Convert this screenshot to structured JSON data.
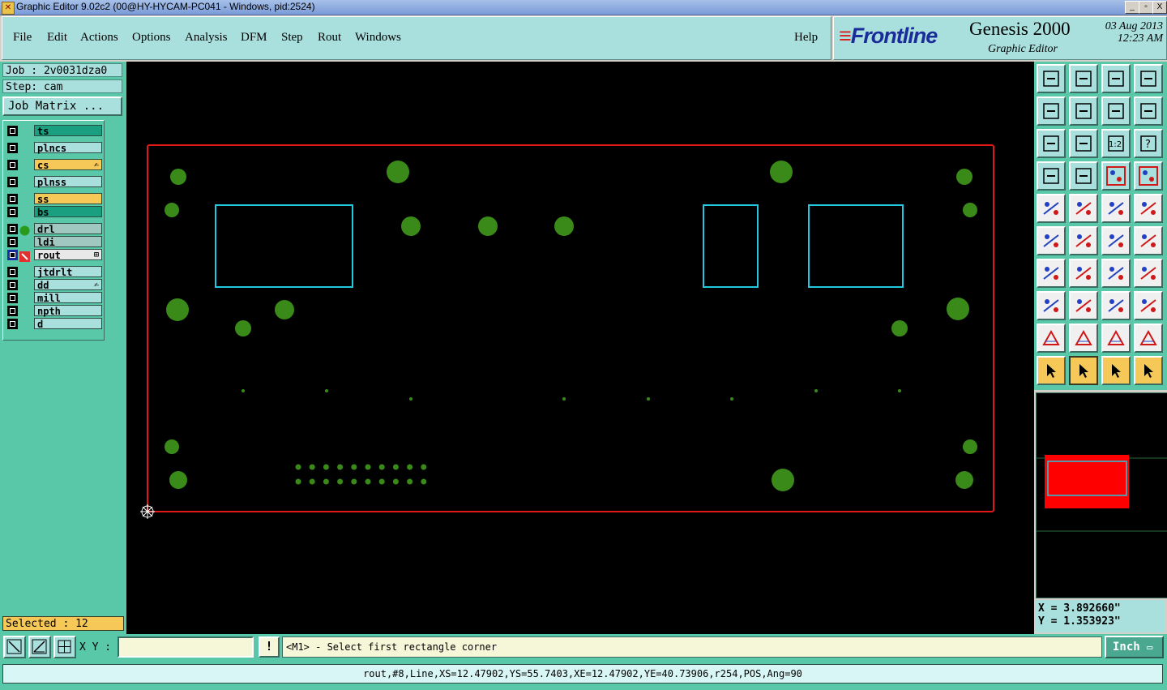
{
  "window": {
    "title": "Graphic Editor 9.02c2 (00@HY-HYCAM-PC041 - Windows, pid:2524)",
    "buttons": [
      "_",
      "▫",
      "X"
    ]
  },
  "menu": {
    "items": [
      "File",
      "Edit",
      "Actions",
      "Options",
      "Analysis",
      "DFM",
      "Step",
      "Rout",
      "Windows"
    ],
    "help": "Help"
  },
  "brand": {
    "logo_text": "Frontline",
    "product": "Genesis 2000",
    "subtitle": "Graphic Editor",
    "date": "03 Aug 2013",
    "time": "12:23 AM"
  },
  "job": {
    "job_line": "Job : 2v0031dza0",
    "step_line": "Step: cam",
    "matrix_button": "Job Matrix ..."
  },
  "layers": [
    {
      "name": "ts",
      "color": "#1aa080",
      "dot": "",
      "mark": ""
    },
    {
      "name": "plncs",
      "color": "#a9e0de",
      "dot": "",
      "mark": ""
    },
    {
      "name": "cs",
      "color": "#f6c858",
      "dot": "",
      "mark": "✍"
    },
    {
      "name": "plnss",
      "color": "#a9e0de",
      "dot": "",
      "mark": ""
    },
    {
      "name": "ss",
      "color": "#f6c858",
      "dot": "",
      "mark": ""
    },
    {
      "name": "bs",
      "color": "#1aa080",
      "dot": "",
      "mark": ""
    },
    {
      "name": "drl",
      "color": "#a0c8c0",
      "dot": "green",
      "mark": ""
    },
    {
      "name": "ldi",
      "color": "#a0c8c0",
      "dot": "",
      "mark": ""
    },
    {
      "name": "rout",
      "color": "#e8e8e8",
      "dot": "pencil",
      "mark": "⊞"
    },
    {
      "name": "jtdrlt",
      "color": "#a9e0de",
      "dot": "",
      "mark": ""
    },
    {
      "name": "dd",
      "color": "#a9e0de",
      "dot": "",
      "mark": "✍"
    },
    {
      "name": "mill",
      "color": "#a9e0de",
      "dot": "",
      "mark": ""
    },
    {
      "name": "npth",
      "color": "#a9e0de",
      "dot": "",
      "mark": ""
    },
    {
      "name": "d",
      "color": "#a9e0de",
      "dot": "",
      "mark": ""
    }
  ],
  "selected": "Selected : 12",
  "coords": {
    "x_line": "X = 3.892660\"",
    "y_line": "Y = 1.353923\""
  },
  "bottom": {
    "xy_label": "X Y :",
    "xy_value": "",
    "excl": "!",
    "prompt": "<M1> - Select first rectangle corner",
    "unit": "Inch"
  },
  "status": "rout,#8,Line,XS=12.47902,YS=55.7403,XE=12.47902,YE=40.73906,r254,POS,Ang=90",
  "colors": {
    "board_outline": "#e01818",
    "pads": "#3a8a1a",
    "rectangles": "#22c8e0",
    "panel": "#58c8a8",
    "panel_light": "#a9e0de"
  }
}
